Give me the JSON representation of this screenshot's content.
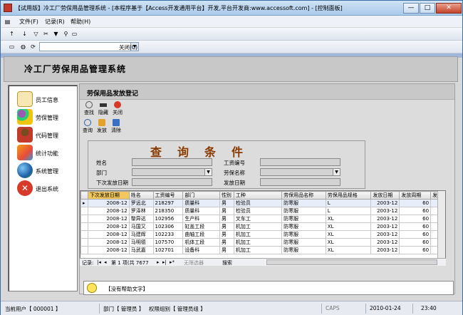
{
  "window": {
    "title": "【试用版】冷工厂劳保用品管理系统 - [本程序基于【Access开发通用平台】开发,平台开发商:www.accessoft.com] - [控制面板]",
    "minimize": "—",
    "maximize": "□",
    "close": "✕"
  },
  "menu": [
    "文件(F)",
    "记录(R)",
    "帮助(H)"
  ],
  "toolbar2": {
    "search_value": "",
    "close_label": "关闭(C)"
  },
  "header": {
    "app_title": "冷工厂劳保用品管理系统"
  },
  "sidebar": {
    "items": [
      {
        "label": "员工信息",
        "icon": "certificate-icon"
      },
      {
        "label": "劳保管理",
        "icon": "molecule-icon"
      },
      {
        "label": "代码管理",
        "icon": "people-icon"
      },
      {
        "label": "统计功能",
        "icon": "chart-icon"
      },
      {
        "label": "系统管理",
        "icon": "globe-icon"
      },
      {
        "label": "退出系统",
        "icon": "exit-icon"
      }
    ]
  },
  "panel": {
    "title": "劳保用品发放登记",
    "actions_row1": [
      "查找",
      "隐藏",
      "关闭"
    ],
    "actions_row2": [
      "查询",
      "发放",
      "清除"
    ]
  },
  "query": {
    "title": "查询条件",
    "fields": {
      "name": "姓名",
      "emp_no": "工资编号",
      "dept": "部门",
      "item_name": "劳保名称",
      "next_date": "下次发放日期",
      "issue_date": "发放日期"
    }
  },
  "grid": {
    "columns": [
      "下次发放日期",
      "姓名",
      "工资编号",
      "部门",
      "性别",
      "工种",
      "劳保用品名称",
      "劳保用品规格",
      "发放日期",
      "发放周期",
      "发"
    ],
    "rows": [
      [
        "2008-12",
        "罗远北",
        "218297",
        "质量科",
        "男",
        "检验员",
        "防寒服",
        "L",
        "2003-12",
        "60"
      ],
      [
        "2008-12",
        "罗泽林",
        "218350",
        "质量科",
        "男",
        "检验员",
        "防寒服",
        "L",
        "2003-12",
        "60"
      ],
      [
        "2008-12",
        "黎异达",
        "102956",
        "生产科",
        "男",
        "叉车工",
        "防寒服",
        "XL",
        "2003-12",
        "60"
      ],
      [
        "2008-12",
        "马国又",
        "102306",
        "缸盖工段",
        "男",
        "机加工",
        "防寒服",
        "XL",
        "2003-12",
        "60"
      ],
      [
        "2008-12",
        "马建辉",
        "102233",
        "曲轴工段",
        "男",
        "机加工",
        "防寒服",
        "XL",
        "2003-12",
        "60"
      ],
      [
        "2008-12",
        "马明德",
        "107570",
        "机体工段",
        "男",
        "机加工",
        "防寒服",
        "XL",
        "2003-12",
        "60"
      ],
      [
        "2008-12",
        "马武嘉",
        "102701",
        "设备科",
        "男",
        "机加工",
        "防寒服",
        "XL",
        "2003-12",
        "60"
      ]
    ],
    "nav": {
      "record_label": "记录:",
      "record_text": "第 1 项(共 7677",
      "no_filter": "无筛选器",
      "search": "搜索"
    }
  },
  "help": {
    "text": "【没有帮助文字】"
  },
  "status": {
    "user": "当前用户【 000001 】",
    "dept": "部门【 管理员 】",
    "group": "权限组别【 管理员组 】",
    "caps": "CAPS",
    "date": "2010-01-24",
    "time": "23:40"
  },
  "colors": {
    "accent": "#f2c75c",
    "query_title": "#8a3a00",
    "exit_icon": "#d63a2a"
  }
}
